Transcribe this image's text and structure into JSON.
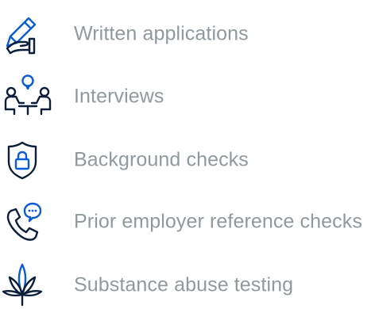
{
  "colors": {
    "icon_blue": "#0a5cd6",
    "icon_dark": "#0b1f3a",
    "label_gray": "#90999d"
  },
  "items": [
    {
      "label": "Written applications",
      "icon": "hand-writing-pen-icon"
    },
    {
      "label": "Interviews",
      "icon": "interview-people-icon"
    },
    {
      "label": "Background checks",
      "icon": "shield-lock-icon"
    },
    {
      "label": "Prior employer reference checks",
      "icon": "phone-chat-icon"
    },
    {
      "label": "Substance abuse testing",
      "icon": "cannabis-leaf-icon"
    }
  ]
}
